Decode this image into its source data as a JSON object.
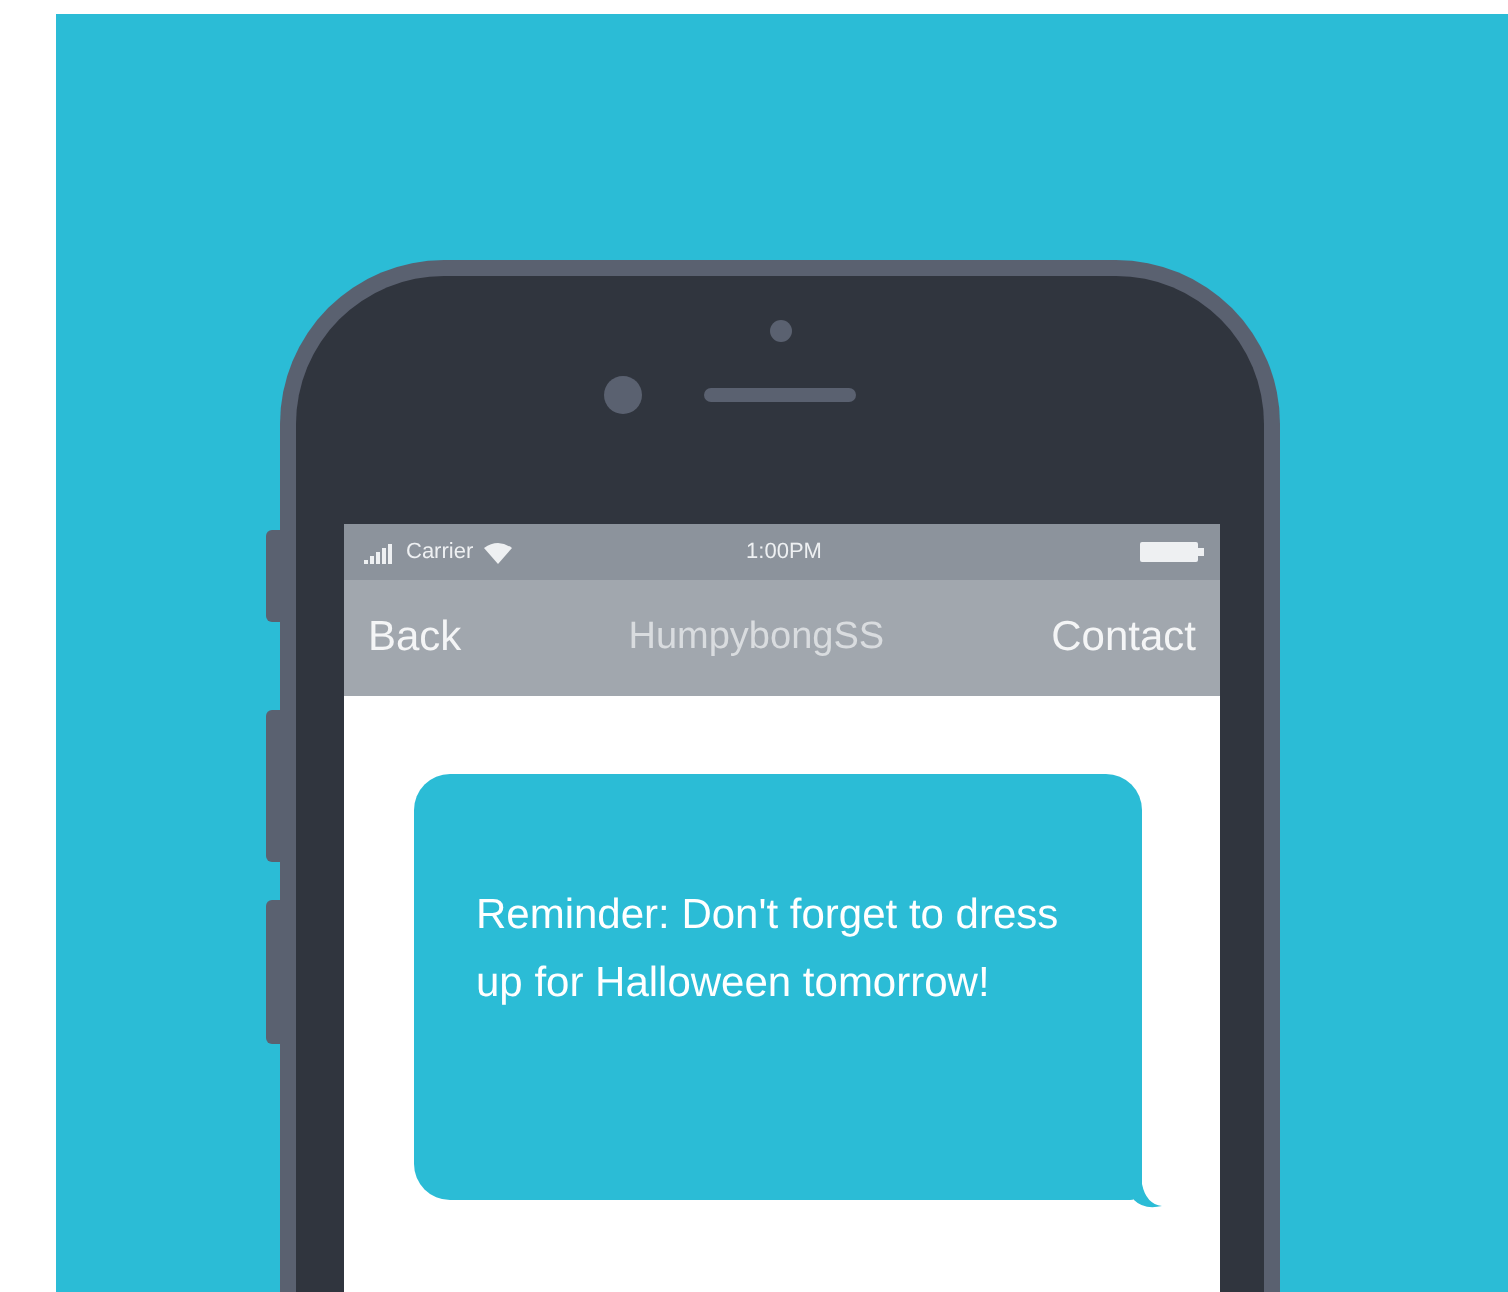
{
  "status_bar": {
    "carrier": "Carrier",
    "time": "1:00PM"
  },
  "nav_bar": {
    "back": "Back",
    "title": "HumpybongSS",
    "action": "Contact"
  },
  "messages": [
    {
      "text": "Reminder: Don't forget to dress up for Halloween tomorrow!"
    }
  ]
}
